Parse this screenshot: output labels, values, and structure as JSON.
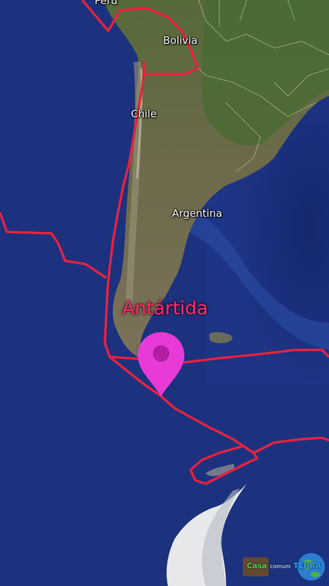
{
  "map": {
    "labels": {
      "peru": "Peru",
      "bolivia": "Bolivia",
      "chile": "Chile",
      "argentina": "Argentina",
      "antartida": "Antártida"
    },
    "colors": {
      "ocean": "#1b2f7a",
      "land": "#6b6a4a",
      "boundary": "#e8213f",
      "pin": "#e83ad6"
    },
    "marker": {
      "icon": "map-pin-icon"
    }
  },
  "watermark": {
    "word1": "Casa",
    "word2": "comum",
    "word3": "TERRA"
  }
}
